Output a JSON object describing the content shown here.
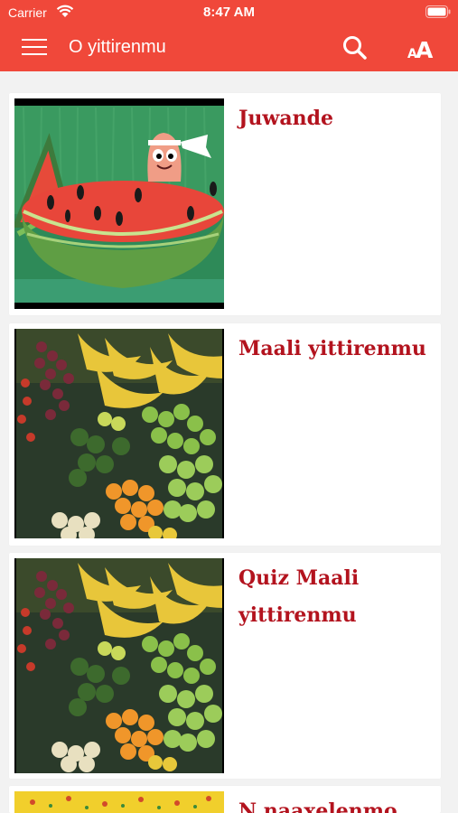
{
  "status_bar": {
    "carrier": "Carrier",
    "time": "8:47 AM"
  },
  "nav": {
    "title": "O yittirenmu",
    "menu_icon": "hamburger-menu-icon",
    "search_icon": "search-icon",
    "font_icon": "font-size-icon"
  },
  "colors": {
    "header": "#f0483a",
    "title": "#b3131e",
    "background": "#f2f2f2"
  },
  "items": [
    {
      "title": "Juwande",
      "image": "watermelon-cartoon"
    },
    {
      "title": "Maali yittirenmu",
      "image": "fruit-market-stall"
    },
    {
      "title": "Quiz Maali yittirenmu",
      "image": "fruit-market-stall"
    },
    {
      "title": "N naaxelenmo",
      "image": "yellow-floral-pattern"
    }
  ]
}
